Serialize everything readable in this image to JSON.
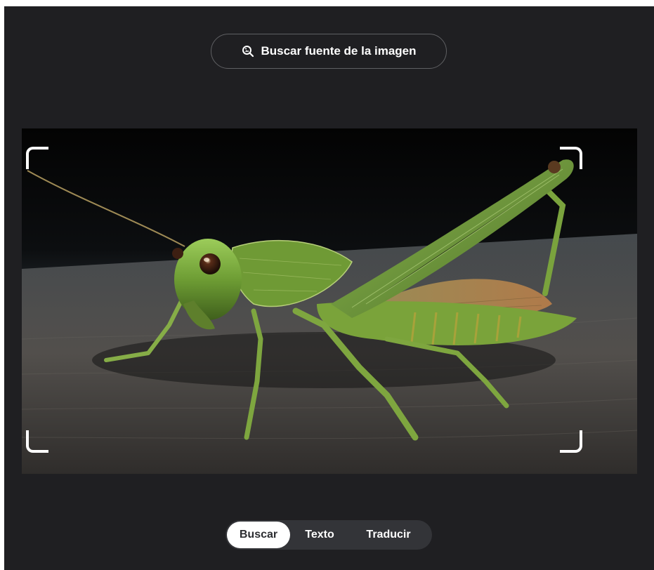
{
  "header": {
    "source_button_label": "Buscar fuente de la imagen",
    "source_icon": "image-search-icon"
  },
  "image": {
    "subject": "grasshopper-photo",
    "crop_handles": [
      "top-left",
      "top-right",
      "bottom-left",
      "bottom-right"
    ]
  },
  "tabs": [
    {
      "label": "Buscar",
      "active": true
    },
    {
      "label": "Texto",
      "active": false
    },
    {
      "label": "Traducir",
      "active": false
    }
  ],
  "colors": {
    "background": "#1f1f22",
    "button_border": "#5f6063",
    "tab_track": "#333438",
    "tab_active_bg": "#ffffff",
    "tab_active_text": "#2b2c30",
    "text": "#ffffff"
  }
}
